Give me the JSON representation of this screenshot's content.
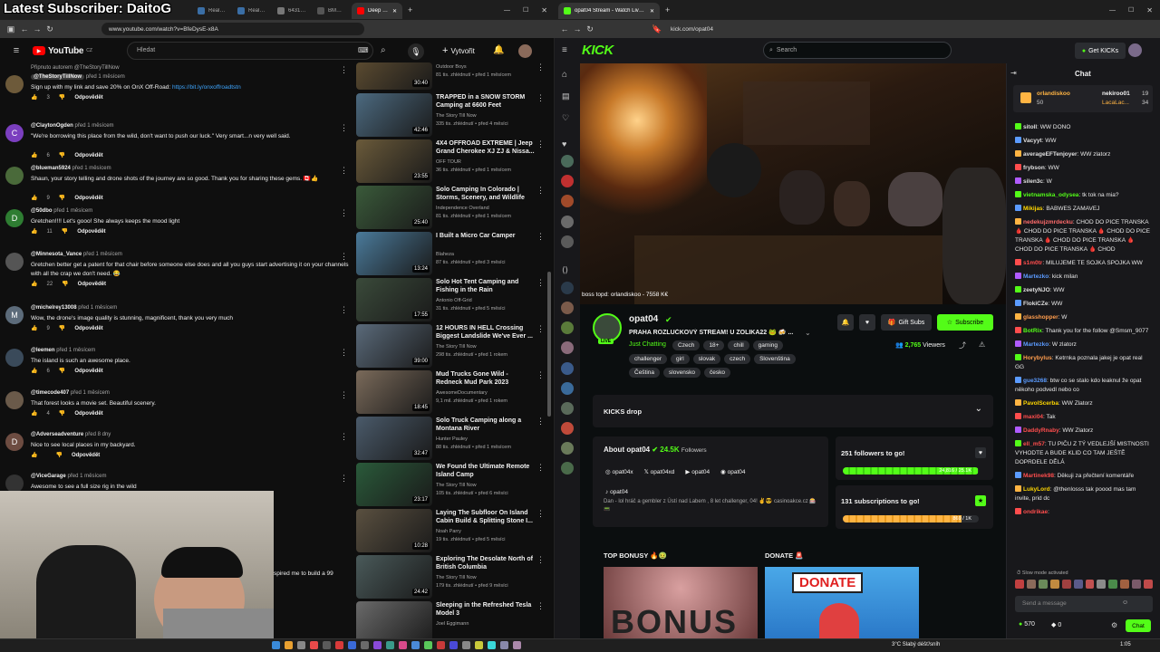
{
  "overlay": {
    "subscriber_text": "Latest Subscriber: DaitoG"
  },
  "left_browser": {
    "tabs": [
      {
        "label": "RealOEM.co",
        "color": "#3a6ea5"
      },
      {
        "label": "RealOEM.co",
        "color": "#3a6ea5"
      },
      {
        "label": "6431692597",
        "color": "#777"
      },
      {
        "label": "BMW e90 e9",
        "color": "#555"
      },
      {
        "label": "Deep Into",
        "color": "#ff0000"
      }
    ],
    "url": "www.youtube.com/watch?v=BfeDysE-x8A"
  },
  "youtube": {
    "logo": "YouTube",
    "region": "CZ",
    "search_placeholder": "Hledat",
    "create_label": "Vytvořit",
    "comments": [
      {
        "pinned": "Připnuto autorem @TheStoryTillNow",
        "author": "@TheStoryTillNow",
        "time": "před 1 měsícem",
        "text": "Sign up with my link and save 20% on OnX Off-Road: ",
        "link": "https://bit.ly/onxoffroadtstn",
        "likes": "3",
        "reply": "Odpovědět",
        "color": "#6d5a3a",
        "initial": ""
      },
      {
        "author": "@ClaytonOgden",
        "time": "před 1 měsícem",
        "text": "\"We're borrowing this place from the wild, don't want to push our luck.\" Very smart...n very well said.",
        "likes": "6",
        "reply": "Odpovědět",
        "color": "#7b3fbf",
        "initial": "C"
      },
      {
        "author": "@blueman5924",
        "time": "před 1 měsícem",
        "text": "Shaun, your story telling and drone shots of the journey are so good. Thank you for sharing these gems. 🇨🇦👍",
        "likes": "9",
        "reply": "Odpovědět",
        "color": "#4a6a3a",
        "initial": ""
      },
      {
        "author": "@50dbo",
        "time": "před 1 měsícem",
        "text": "Gretchen!!!! Let's gooo!  She always keeps the mood light",
        "likes": "11",
        "reply": "Odpovědět",
        "color": "#2e7d32",
        "initial": "D"
      },
      {
        "author": "@Minnesota_Vance",
        "time": "před 1 měsícem",
        "text": "Gretchen better get a patent for that chair before someone else does and all you guys start advertising it on your channels with all the crap we don't need. 😂",
        "likes": "22",
        "reply": "Odpovědět",
        "color": "#555",
        "initial": ""
      },
      {
        "author": "@michelrey13008",
        "time": "před 1 měsícem",
        "text": "Wow, the drone's image quality is stunning, magnificent, thank you very much",
        "likes": "9",
        "reply": "Odpovědět",
        "color": "#5c6b7a",
        "initial": "M"
      },
      {
        "author": "@leemen",
        "time": "před 1 měsícem",
        "text": "The island is such an awesome place.",
        "likes": "6",
        "reply": "Odpovědět",
        "color": "#3a4a5a",
        "initial": ""
      },
      {
        "author": "@timecode407",
        "time": "před 1 měsícem",
        "text": "That forest looks a movie set. Beautiful scenery.",
        "likes": "4",
        "reply": "Odpovědět",
        "color": "#6a5a4a",
        "initial": ""
      },
      {
        "author": "@Adverseadventure",
        "time": "před 8 dny",
        "text": "Nice to see local places in my backyard.",
        "likes": "",
        "reply": "Odpovědět",
        "color": "#6d4c41",
        "initial": "D"
      },
      {
        "author": "@ViceGarage",
        "time": "před 1 měsícem",
        "text": "Awesome to see a full size rig in the wild",
        "likes": "",
        "reply": "",
        "color": "#333",
        "initial": ""
      }
    ],
    "partial_comment": "spired me to build a 99",
    "videos": [
      {
        "title": "",
        "channel": "Outdoor Boys",
        "meta": "81 tis. zhlédnutí • před 1 měsícem",
        "duration": "30:40",
        "color": "#5a4a30"
      },
      {
        "title": "TRAPPED in a SNOW STORM Camping at 6600 Feet",
        "channel": "The Story Till Now",
        "meta": "335 tis. zhlédnutí • před 4 měsíci",
        "duration": "42:46",
        "color": "#4c6a80"
      },
      {
        "title": "4X4 OFFROAD EXTREME | Jeep Grand Cherokee XJ ZJ & Nissa...",
        "channel": "OFF TOUR",
        "meta": "36 tis. zhlédnutí • před 1 měsícem",
        "duration": "23:55",
        "color": "#6a5a3a"
      },
      {
        "title": "Solo Camping In Colorado | Storms, Scenery, and Wildlife",
        "channel": "Independence Overland",
        "meta": "81 tis. zhlédnutí • před 1 měsícem",
        "duration": "25:40",
        "color": "#3a5a3a"
      },
      {
        "title": "I Built a Micro Car Camper",
        "channel": "Blaheza",
        "meta": "87 tis. zhlédnutí • před 3 měsíci",
        "duration": "13:24",
        "color": "#4a7a9a"
      },
      {
        "title": "Solo Hot Tent Camping and Fishing in the Rain",
        "channel": "Antonio Off-Grid",
        "meta": "31 tis. zhlédnutí • před 5 měsíci",
        "duration": "17:55",
        "color": "#3a4a3a"
      },
      {
        "title": "12 HOURS IN HELL Crossing Biggest Landslide We've Ever ...",
        "channel": "The Story Till Now",
        "meta": "298 tis. zhlédnutí • před 1 rokem",
        "duration": "39:00",
        "color": "#5a6a7a"
      },
      {
        "title": "Mud Trucks Gone Wild - Redneck Mud Park 2023",
        "channel": "AwesomeDocumentary",
        "meta": "9,1 mil. zhlédnutí • před 1 rokem",
        "duration": "18:45",
        "color": "#7a6a5a"
      },
      {
        "title": "Solo Truck Camping along a Montana River",
        "channel": "Hunter Pauley",
        "meta": "88 tis. zhlédnutí • před 1 měsícem",
        "duration": "32:47",
        "color": "#4a5a6a"
      },
      {
        "title": "We Found the Ultimate Remote Island Camp",
        "channel": "The Story Till Now",
        "meta": "105 tis. zhlédnutí • před 6 měsíci",
        "duration": "23:17",
        "color": "#2a5a3a"
      },
      {
        "title": "Laying The Subfloor On Island Cabin Build & Splitting Stone I...",
        "channel": "Noah Parry",
        "meta": "19 tis. zhlédnutí • před 5 měsíci",
        "duration": "10:28",
        "color": "#5a5040"
      },
      {
        "title": "Exploring The Desolate North of British Columbia",
        "channel": "The Story Till Now",
        "meta": "179 tis. zhlédnutí • před 9 měsíci",
        "duration": "24:42",
        "color": "#4a5a5a"
      },
      {
        "title": "Sleeping in the Refreshed Tesla Model 3",
        "channel": "Joel Eggimann",
        "meta": "",
        "duration": "",
        "color": "#6a6a6a"
      }
    ]
  },
  "right_browser": {
    "tab": "opat04 Stream - Watch Live o",
    "url": "kick.com/opat04"
  },
  "kick": {
    "logo": "KICK",
    "search_placeholder": "Search",
    "get_kicks": "Get KICKs",
    "boss_topd": "boss topd:",
    "boss_name": "orlandiskoo",
    "boss_amount": "- 7558 K€",
    "streamer": "opat04",
    "title": "PRAHA ROZLUČKOVÝ STREAM! U ZOLIKA22 🐸 🍻 ...",
    "category": "Just Chatting",
    "live": "LIVE",
    "tags": [
      "Czech",
      "18+",
      "chill",
      "gaming",
      "challenger",
      "girl",
      "slovak",
      "czech",
      "Slovenština",
      "Čeština",
      "slovensko",
      "česko"
    ],
    "viewers": "2,765",
    "viewers_label": "Viewers",
    "gift_subs": "Gift Subs",
    "subscribe": "Subscribe",
    "kicks_drop": "KICKS drop",
    "about": "About opat04",
    "followers_count": "24.5K",
    "followers_label": "Followers",
    "socials": [
      "opat04x",
      "opat04xd",
      "opat04",
      "opat04",
      "opat04"
    ],
    "bio": "Dan - lol hráč a gembler z Ústí nad Labem , 8 let challenger, 04! ✌😎 casinoakce.cz 🎰📟",
    "goal1": {
      "label": "251 followers to go!",
      "progress": "24,816 / 25.1K",
      "fraction": 0.99
    },
    "goal2": {
      "label": "131 subscriptions to go!",
      "progress": "869 / 1K",
      "fraction": 0.87
    },
    "panel1": "TOP BONUSY 🔥🤢",
    "panel2": "DONATE 🚨",
    "panel1_text": "BONUS",
    "panel2_text": "DONATE",
    "chat": {
      "title": "Chat",
      "top1": {
        "name": "orlandiskoo",
        "amount": "50"
      },
      "top2": {
        "name": "nekiroo01",
        "amount": "19"
      },
      "top3": {
        "name": "LacaLac...",
        "amount": "34"
      },
      "messages": [
        {
          "user": "sitoll",
          "text": "WW DONO",
          "color": "#e0e0e0"
        },
        {
          "user": "Vacyyt",
          "text": "WW",
          "color": "#e0e0e0"
        },
        {
          "user": "averageEFTenjoyer",
          "text": "WW zlatorz",
          "color": "#e0e0e0"
        },
        {
          "user": "frybson",
          "text": "WW",
          "color": "#e0e0e0"
        },
        {
          "user": "silen3c",
          "text": "W",
          "color": "#e0e0e0"
        },
        {
          "user": "vietnamska_odysea",
          "text": "tk tok na mia?",
          "color": "#53fc18"
        },
        {
          "user": "Mikijas",
          "text": "BABWES ZAMAVEJ",
          "color": "#ffd700"
        },
        {
          "user": "nedekujzmrdecku",
          "text": "CHOD DO PICE TRANSKA 🩸 CHOD DO PICE TRANSKA 🩸 CHOD DO PICE TRANSKA 🩸 CHOD DO PICE TRANSKA 🩸 CHOD DO PICE TRANSKA 🩸 CHOD",
          "color": "#ff6b6b"
        },
        {
          "user": "s1m0tr",
          "text": "MILUJEME TE SOJKA SPOJKA WW",
          "color": "#ff4d4d"
        },
        {
          "user": "Martezko",
          "text": "kick milan",
          "color": "#5b9bff"
        },
        {
          "user": "zeetyNJO",
          "text": "WW",
          "color": "#e0e0e0"
        },
        {
          "user": "FlokiCZe",
          "text": "WW",
          "color": "#e0e0e0"
        },
        {
          "user": "glasshopper",
          "text": "W",
          "color": "#ff9d4d"
        },
        {
          "user": "BotRix",
          "text": "Thank you for the follow @Smsm_9077",
          "color": "#53fc18"
        },
        {
          "user": "Martezko",
          "text": "W zlatorz",
          "color": "#5b9bff"
        },
        {
          "user": "Horybylus",
          "text": "Ketrnka poznala jakej je opat real GG",
          "color": "#ff9d4d"
        },
        {
          "user": "gue3268",
          "text": "btw co se stalo kdo leaknul že opat někoho podvedl nebo co",
          "color": "#5b9bff"
        },
        {
          "user": "PavolScerba",
          "text": "WW Zlatorz",
          "color": "#ffd700"
        },
        {
          "user": "maxi04",
          "text": "Tak",
          "color": "#ff4d4d"
        },
        {
          "user": "DaddyRnaby",
          "text": "WW Zlatorz",
          "color": "#ff4d4d"
        },
        {
          "user": "ell_m57",
          "text": "TU PIČU Z TÝ VEDLEJŠÍ MISTNOSTI VYHODTE A BUDE KLID CO TAM JEŠTĚ DOPRDELE DĚLÁ",
          "color": "#ff4d4d"
        },
        {
          "user": "Martinek98",
          "text": "Děkuji za přečtení komentáře",
          "color": "#ff4d4d"
        },
        {
          "user": "LukyLord",
          "text": "@thenlosss tak poood mas tam invite, prid dc",
          "color": "#ffd700"
        },
        {
          "user": "ondrikae",
          "text": "",
          "color": "#ff4d4d"
        }
      ],
      "slow_mode": "Slow mode activated",
      "send_placeholder": "Send a message",
      "kicks_balance": "570",
      "points": "0",
      "chat_button": "Chat"
    }
  },
  "taskbar": {
    "weather": "3°C",
    "weather_text": "Slabý déšť/sníh",
    "time": "1:05"
  }
}
